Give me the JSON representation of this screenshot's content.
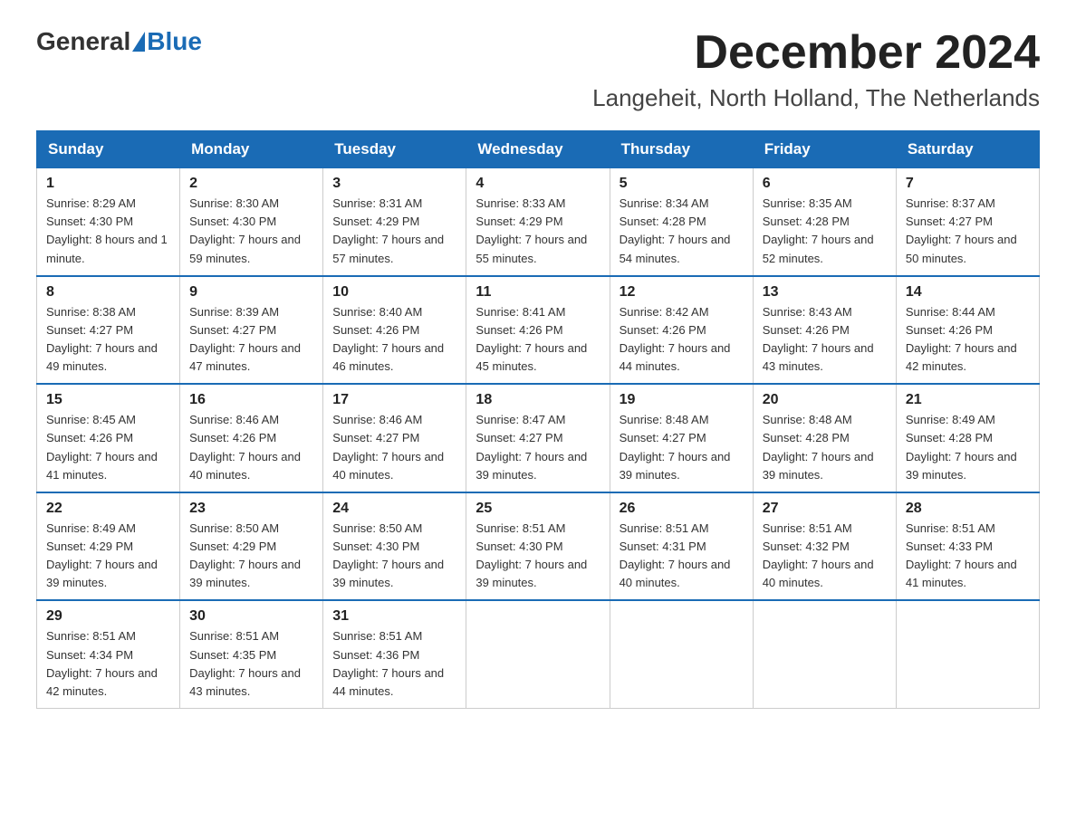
{
  "logo": {
    "general": "General",
    "blue": "Blue"
  },
  "title": "December 2024",
  "location": "Langeheit, North Holland, The Netherlands",
  "days_of_week": [
    "Sunday",
    "Monday",
    "Tuesday",
    "Wednesday",
    "Thursday",
    "Friday",
    "Saturday"
  ],
  "weeks": [
    [
      {
        "day": "1",
        "sunrise": "8:29 AM",
        "sunset": "4:30 PM",
        "daylight": "8 hours and 1 minute."
      },
      {
        "day": "2",
        "sunrise": "8:30 AM",
        "sunset": "4:30 PM",
        "daylight": "7 hours and 59 minutes."
      },
      {
        "day": "3",
        "sunrise": "8:31 AM",
        "sunset": "4:29 PM",
        "daylight": "7 hours and 57 minutes."
      },
      {
        "day": "4",
        "sunrise": "8:33 AM",
        "sunset": "4:29 PM",
        "daylight": "7 hours and 55 minutes."
      },
      {
        "day": "5",
        "sunrise": "8:34 AM",
        "sunset": "4:28 PM",
        "daylight": "7 hours and 54 minutes."
      },
      {
        "day": "6",
        "sunrise": "8:35 AM",
        "sunset": "4:28 PM",
        "daylight": "7 hours and 52 minutes."
      },
      {
        "day": "7",
        "sunrise": "8:37 AM",
        "sunset": "4:27 PM",
        "daylight": "7 hours and 50 minutes."
      }
    ],
    [
      {
        "day": "8",
        "sunrise": "8:38 AM",
        "sunset": "4:27 PM",
        "daylight": "7 hours and 49 minutes."
      },
      {
        "day": "9",
        "sunrise": "8:39 AM",
        "sunset": "4:27 PM",
        "daylight": "7 hours and 47 minutes."
      },
      {
        "day": "10",
        "sunrise": "8:40 AM",
        "sunset": "4:26 PM",
        "daylight": "7 hours and 46 minutes."
      },
      {
        "day": "11",
        "sunrise": "8:41 AM",
        "sunset": "4:26 PM",
        "daylight": "7 hours and 45 minutes."
      },
      {
        "day": "12",
        "sunrise": "8:42 AM",
        "sunset": "4:26 PM",
        "daylight": "7 hours and 44 minutes."
      },
      {
        "day": "13",
        "sunrise": "8:43 AM",
        "sunset": "4:26 PM",
        "daylight": "7 hours and 43 minutes."
      },
      {
        "day": "14",
        "sunrise": "8:44 AM",
        "sunset": "4:26 PM",
        "daylight": "7 hours and 42 minutes."
      }
    ],
    [
      {
        "day": "15",
        "sunrise": "8:45 AM",
        "sunset": "4:26 PM",
        "daylight": "7 hours and 41 minutes."
      },
      {
        "day": "16",
        "sunrise": "8:46 AM",
        "sunset": "4:26 PM",
        "daylight": "7 hours and 40 minutes."
      },
      {
        "day": "17",
        "sunrise": "8:46 AM",
        "sunset": "4:27 PM",
        "daylight": "7 hours and 40 minutes."
      },
      {
        "day": "18",
        "sunrise": "8:47 AM",
        "sunset": "4:27 PM",
        "daylight": "7 hours and 39 minutes."
      },
      {
        "day": "19",
        "sunrise": "8:48 AM",
        "sunset": "4:27 PM",
        "daylight": "7 hours and 39 minutes."
      },
      {
        "day": "20",
        "sunrise": "8:48 AM",
        "sunset": "4:28 PM",
        "daylight": "7 hours and 39 minutes."
      },
      {
        "day": "21",
        "sunrise": "8:49 AM",
        "sunset": "4:28 PM",
        "daylight": "7 hours and 39 minutes."
      }
    ],
    [
      {
        "day": "22",
        "sunrise": "8:49 AM",
        "sunset": "4:29 PM",
        "daylight": "7 hours and 39 minutes."
      },
      {
        "day": "23",
        "sunrise": "8:50 AM",
        "sunset": "4:29 PM",
        "daylight": "7 hours and 39 minutes."
      },
      {
        "day": "24",
        "sunrise": "8:50 AM",
        "sunset": "4:30 PM",
        "daylight": "7 hours and 39 minutes."
      },
      {
        "day": "25",
        "sunrise": "8:51 AM",
        "sunset": "4:30 PM",
        "daylight": "7 hours and 39 minutes."
      },
      {
        "day": "26",
        "sunrise": "8:51 AM",
        "sunset": "4:31 PM",
        "daylight": "7 hours and 40 minutes."
      },
      {
        "day": "27",
        "sunrise": "8:51 AM",
        "sunset": "4:32 PM",
        "daylight": "7 hours and 40 minutes."
      },
      {
        "day": "28",
        "sunrise": "8:51 AM",
        "sunset": "4:33 PM",
        "daylight": "7 hours and 41 minutes."
      }
    ],
    [
      {
        "day": "29",
        "sunrise": "8:51 AM",
        "sunset": "4:34 PM",
        "daylight": "7 hours and 42 minutes."
      },
      {
        "day": "30",
        "sunrise": "8:51 AM",
        "sunset": "4:35 PM",
        "daylight": "7 hours and 43 minutes."
      },
      {
        "day": "31",
        "sunrise": "8:51 AM",
        "sunset": "4:36 PM",
        "daylight": "7 hours and 44 minutes."
      },
      null,
      null,
      null,
      null
    ]
  ]
}
